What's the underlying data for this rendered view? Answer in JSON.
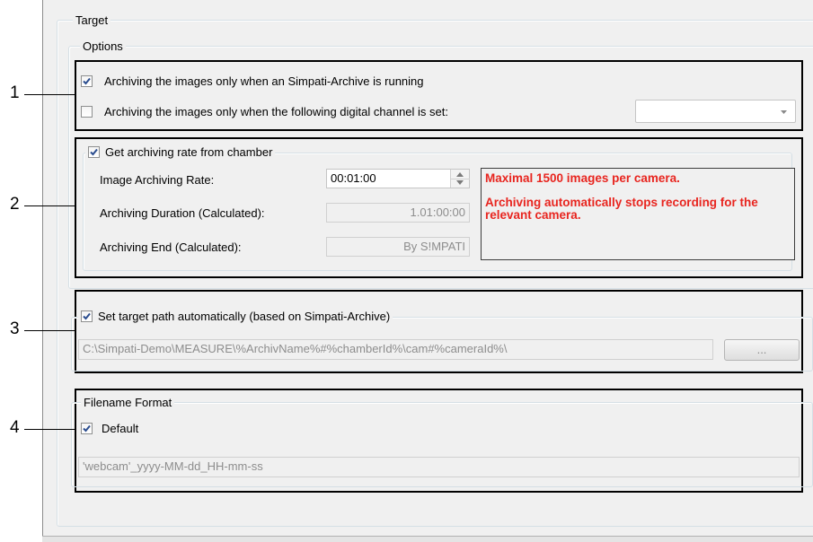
{
  "target_group": {
    "title": "Target"
  },
  "options_group": {
    "title": "Options"
  },
  "section1": {
    "archive_running": {
      "label": "Archiving the images only when an Simpati-Archive is running",
      "checked": true
    },
    "digital_channel": {
      "label": "Archiving the images only when the following digital channel is set:",
      "checked": false,
      "value": ""
    }
  },
  "section2": {
    "group_label": "Get archiving rate from chamber",
    "checked": true,
    "rate_label": "Image Archiving Rate:",
    "rate_value": "00:01:00",
    "duration_label": "Archiving Duration (Calculated):",
    "duration_value": "1.01:00:00",
    "end_label": "Archiving End (Calculated):",
    "end_value": "By S!MPATI",
    "warning_line1": "Maximal  1500 images per camera.",
    "warning_line2": "Archiving automatically stops recording for the relevant camera."
  },
  "section3": {
    "group_label": "Set target path automatically (based on Simpati-Archive)",
    "checked": true,
    "path_value": "C:\\Simpati-Demo\\MEASURE\\%ArchivName%#%chamberId%\\cam#%cameraId%\\",
    "browse_label": "..."
  },
  "section4": {
    "group_label": "Filename Format",
    "default_label": "Default",
    "checked": true,
    "format_value": "'webcam'_yyyy-MM-dd_HH-mm-ss"
  },
  "callouts": [
    "1",
    "2",
    "3",
    "4"
  ],
  "colors": {
    "warning_text": "#e8251f",
    "checkmark": "#2b4d8f"
  }
}
